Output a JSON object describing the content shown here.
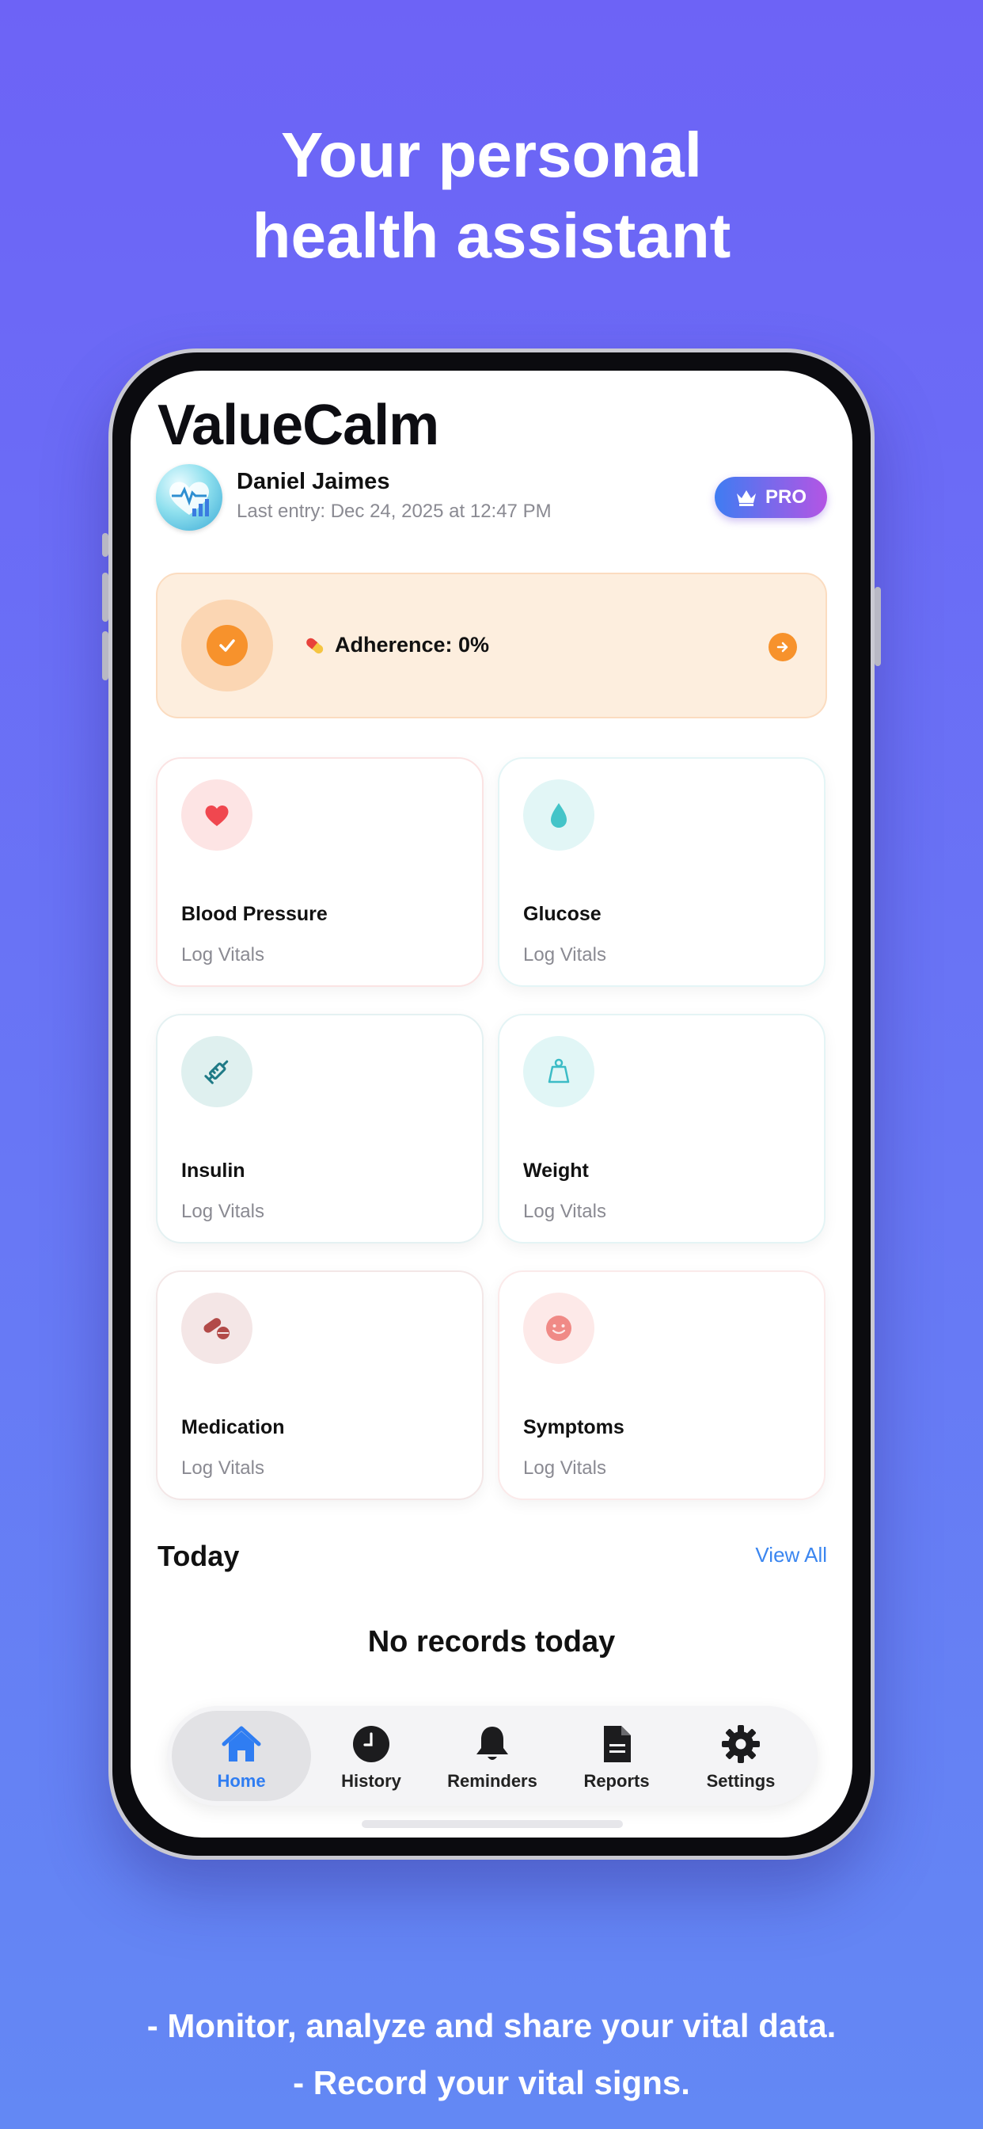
{
  "marketing": {
    "headline_line1": "Your personal",
    "headline_line2": "health assistant",
    "footer_line1": "- Monitor, analyze and share your vital data.",
    "footer_line2": "- Record your vital signs."
  },
  "app": {
    "title": "ValueCalm"
  },
  "user": {
    "name": "Daniel Jaimes",
    "last_entry": "Last entry: Dec 24, 2025 at 12:47 PM",
    "pro_label": "PRO"
  },
  "adherence": {
    "label": "Adherence: 0%",
    "percent": 0
  },
  "cards": [
    {
      "title": "Blood Pressure",
      "subtitle": "Log Vitals",
      "icon": "heart-icon",
      "color": "#f0474f"
    },
    {
      "title": "Glucose",
      "subtitle": "Log Vitals",
      "icon": "drop-icon",
      "color": "#44c4c8"
    },
    {
      "title": "Insulin",
      "subtitle": "Log Vitals",
      "icon": "syringe-icon",
      "color": "#1f7a86"
    },
    {
      "title": "Weight",
      "subtitle": "Log Vitals",
      "icon": "weight-icon",
      "color": "#3cbcc6"
    },
    {
      "title": "Medication",
      "subtitle": "Log Vitals",
      "icon": "pills-icon",
      "color": "#b24a48"
    },
    {
      "title": "Symptoms",
      "subtitle": "Log Vitals",
      "icon": "smiley-icon",
      "color": "#f08a86"
    }
  ],
  "today": {
    "heading": "Today",
    "view_all": "View All",
    "empty": "No records today"
  },
  "tabs": [
    {
      "label": "Home",
      "icon": "home-icon",
      "active": true
    },
    {
      "label": "History",
      "icon": "clock-icon",
      "active": false
    },
    {
      "label": "Reminders",
      "icon": "bell-icon",
      "active": false
    },
    {
      "label": "Reports",
      "icon": "document-icon",
      "active": false
    },
    {
      "label": "Settings",
      "icon": "gear-icon",
      "active": false
    }
  ],
  "colors": {
    "accent_blue": "#2f7df2",
    "accent_orange": "#f7922c",
    "background_top": "#6d63f6",
    "background_bottom": "#6388f4"
  }
}
